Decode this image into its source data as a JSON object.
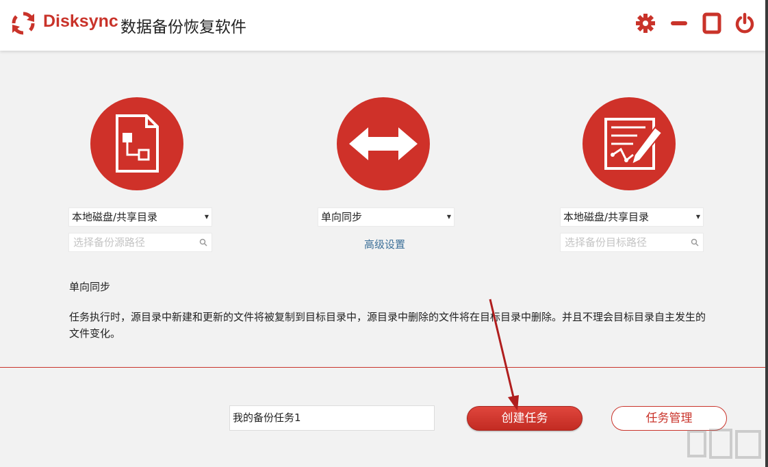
{
  "titlebar": {
    "brand": "Disksync",
    "title": "数据备份恢复软件"
  },
  "source": {
    "type_selected": "本地磁盘/共享目录",
    "path_placeholder": "选择备份源路径"
  },
  "sync": {
    "mode_selected": "单向同步",
    "advanced_link": "高级设置"
  },
  "target": {
    "type_selected": "本地磁盘/共享目录",
    "path_placeholder": "选择备份目标路径"
  },
  "description": {
    "title": "单向同步",
    "text": "任务执行时，源目录中新建和更新的文件将被复制到目标目录中，源目录中删除的文件将在目标目录中删除。并且不理会目标目录自主发生的文件变化。"
  },
  "footer": {
    "task_name_value": "我的备份任务1",
    "create_button": "创建任务",
    "manage_button": "任务管理"
  },
  "colors": {
    "accent": "#cf3129",
    "link": "#3b6f98"
  }
}
